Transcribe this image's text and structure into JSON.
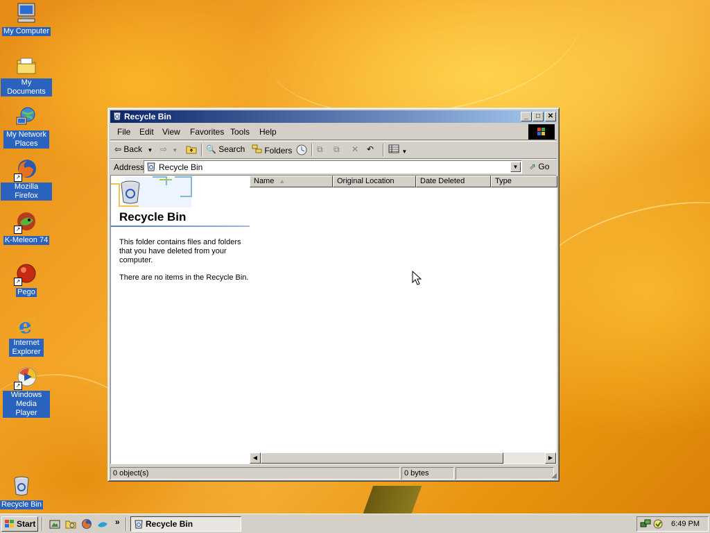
{
  "desktop": {
    "icons": [
      {
        "label": "My Computer",
        "icon": "computer-icon"
      },
      {
        "label": "My Documents",
        "icon": "folder-icon"
      },
      {
        "label": "My Network Places",
        "icon": "network-icon"
      },
      {
        "label": "Mozilla Firefox",
        "icon": "firefox-icon"
      },
      {
        "label": "K-Meleon 74",
        "icon": "kmeleon-icon"
      },
      {
        "label": "Pego",
        "icon": "pego-icon"
      },
      {
        "label": "Internet Explorer",
        "icon": "ie-icon"
      },
      {
        "label": "Windows Media Player",
        "icon": "media-player-icon"
      },
      {
        "label": "Recycle Bin",
        "icon": "recycle-bin-icon"
      }
    ]
  },
  "window": {
    "title": "Recycle Bin",
    "controls": {
      "minimize": "_",
      "maximize": "□",
      "close": "✕"
    },
    "menu": [
      "File",
      "Edit",
      "View",
      "Favorites",
      "Tools",
      "Help"
    ],
    "toolbar": {
      "back": "Back",
      "search": "Search",
      "folders": "Folders"
    },
    "address": {
      "label": "Address",
      "value": "Recycle Bin",
      "go": "Go"
    },
    "left_pane": {
      "title": "Recycle Bin",
      "description": "This folder contains files and folders that you have deleted from your computer.",
      "empty_note": "There are no items in the Recycle Bin."
    },
    "columns": [
      "Name",
      "Original Location",
      "Date Deleted",
      "Type"
    ],
    "status": {
      "objects": "0 object(s)",
      "size": "0 bytes"
    }
  },
  "taskbar": {
    "start_label": "Start",
    "task": "Recycle Bin",
    "chevron": "»",
    "clock": "6:49 PM"
  },
  "colors": {
    "titlebar_start": "#0a246a",
    "titlebar_end": "#a6caf0",
    "face": "#d4d0c8",
    "icon_label_bg": "#2a63bd"
  }
}
